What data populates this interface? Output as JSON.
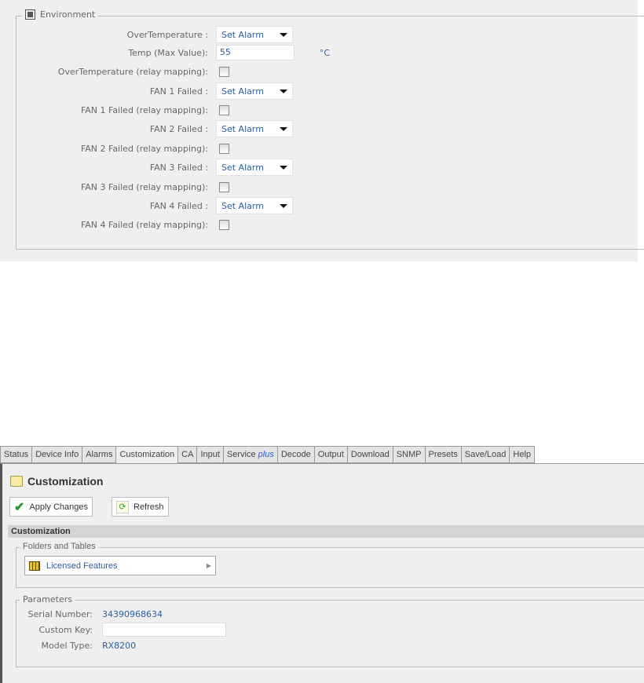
{
  "environment": {
    "legend": "Environment",
    "rows": [
      {
        "label": "OverTemperature :",
        "type": "select",
        "value": "Set Alarm"
      },
      {
        "label": "Temp (Max Value):",
        "type": "input",
        "value": "55",
        "unit": "°C"
      },
      {
        "label": "OverTemperature (relay mapping):",
        "type": "checkbox",
        "checked": false
      },
      {
        "label": "FAN 1 Failed :",
        "type": "select",
        "value": "Set Alarm"
      },
      {
        "label": "FAN 1 Failed (relay mapping):",
        "type": "checkbox",
        "checked": false
      },
      {
        "label": "FAN 2 Failed :",
        "type": "select",
        "value": "Set Alarm"
      },
      {
        "label": "FAN 2 Failed (relay mapping):",
        "type": "checkbox",
        "checked": false
      },
      {
        "label": "FAN 3 Failed :",
        "type": "select",
        "value": "Set Alarm"
      },
      {
        "label": "FAN 3 Failed (relay mapping):",
        "type": "checkbox",
        "checked": false
      },
      {
        "label": "FAN 4 Failed :",
        "type": "select",
        "value": "Set Alarm"
      },
      {
        "label": "FAN 4 Failed (relay mapping):",
        "type": "checkbox",
        "checked": false
      }
    ]
  },
  "tabs": [
    {
      "label": "Status"
    },
    {
      "label": "Device Info"
    },
    {
      "label": "Alarms"
    },
    {
      "label": "Customization",
      "active": true
    },
    {
      "label": "CA"
    },
    {
      "label": "Input"
    },
    {
      "label": "Service",
      "suffix": "plus"
    },
    {
      "label": "Decode"
    },
    {
      "label": "Output"
    },
    {
      "label": "Download"
    },
    {
      "label": "SNMP"
    },
    {
      "label": "Presets"
    },
    {
      "label": "Save/Load"
    },
    {
      "label": "Help"
    }
  ],
  "page": {
    "title": "Customization",
    "apply_label": "Apply Changes",
    "refresh_label": "Refresh",
    "section_header": "Customization",
    "folders_legend": "Folders and Tables",
    "licensed_features": "Licensed Features",
    "params_legend": "Parameters",
    "serial_label": "Serial Number:",
    "serial_value": "34390968634",
    "custom_key_label": "Custom Key:",
    "custom_key_value": "",
    "model_label": "Model Type:",
    "model_value": "RX8200"
  },
  "colors": {
    "accent": "#2c5f9e",
    "panel_bg": "#efefef",
    "header_bar": "#d4d4d4"
  }
}
